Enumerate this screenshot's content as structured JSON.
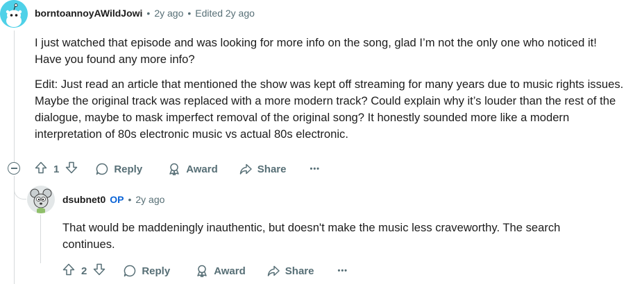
{
  "comment1": {
    "author": "borntoannoyAWildJowi",
    "time": "2y ago",
    "edited": "Edited 2y ago",
    "paragraphs": [
      "I just watched that episode and was looking for more info on the song, glad I’m not the only one who noticed it! Have you found any more info?",
      "Edit: Just read an article that mentioned the show was kept off streaming for many years due to music rights issues. Maybe the original track was replaced with a more modern track? Could explain why it’s louder than the rest of the dialogue, maybe to mask imperfect removal of the original song? It honestly sounded more like a modern interpretation of 80s electronic music vs actual 80s electronic."
    ],
    "score": "1",
    "reply_label": "Reply",
    "award_label": "Award",
    "share_label": "Share",
    "more_label": "•••"
  },
  "comment2": {
    "author": "dsubnet0",
    "op_badge": "OP",
    "time": "2y ago",
    "paragraphs": [
      "That would be maddeningly inauthentic, but doesn't make the music less craveworthy. The search continues."
    ],
    "score": "2",
    "reply_label": "Reply",
    "award_label": "Award",
    "share_label": "Share",
    "more_label": "•••"
  },
  "colors": {
    "avatar1_bg": "#4fd1e8",
    "op": "#0a63d6",
    "meta": "#576f76",
    "thread_line": "#d7dadc"
  },
  "icons": [
    "snoo-avatar-icon",
    "mouse-avatar-icon",
    "upvote-icon",
    "downvote-icon",
    "reply-bubble-icon",
    "award-icon",
    "share-arrow-icon",
    "more-dots-icon",
    "collapse-minus-icon"
  ]
}
